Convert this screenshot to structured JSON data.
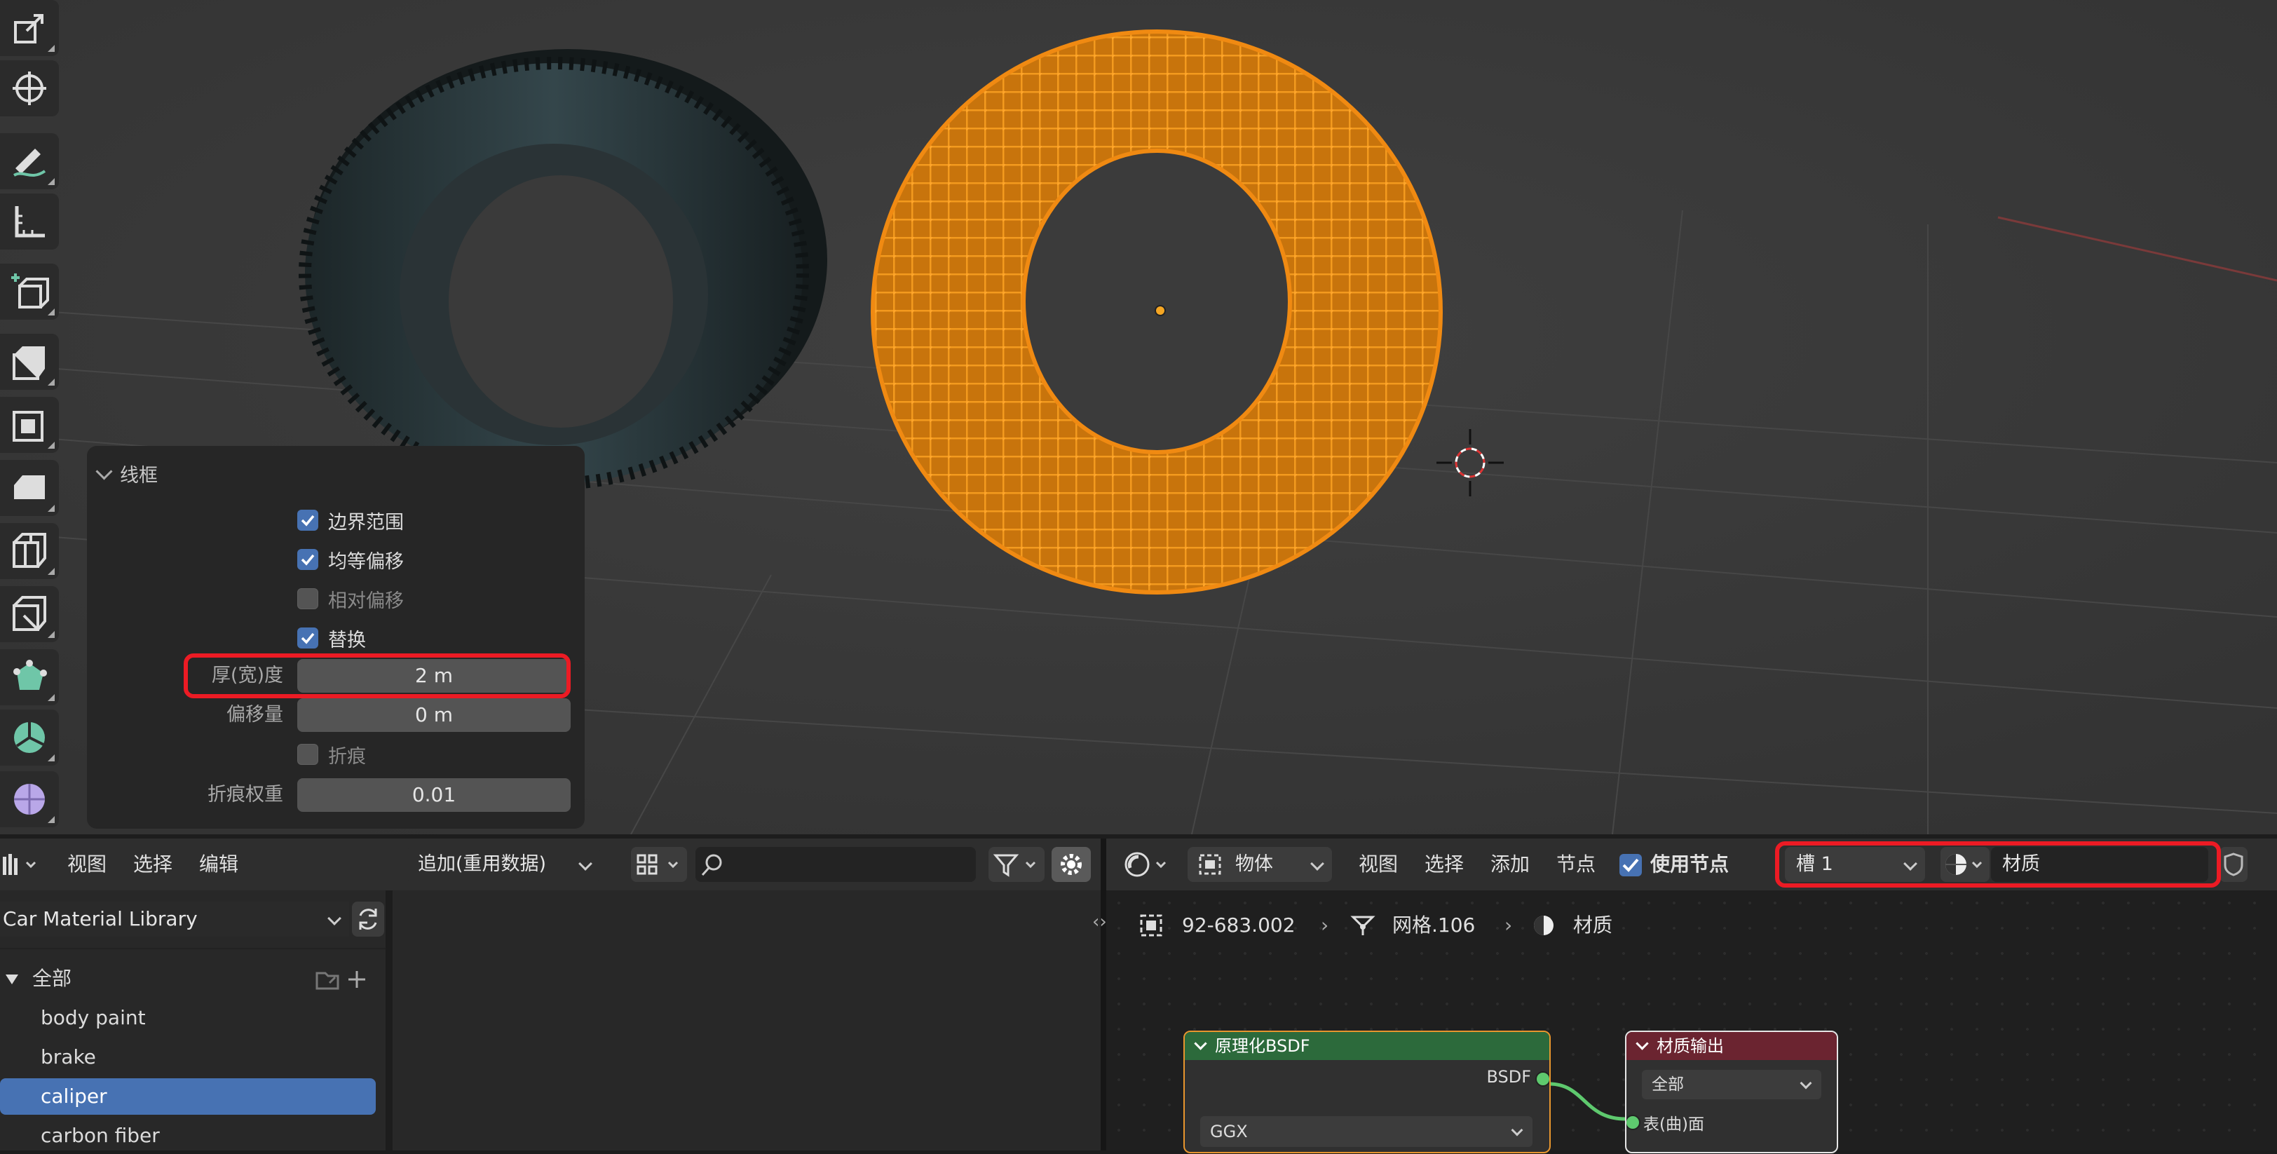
{
  "redo_panel": {
    "title": "线框",
    "checkboxes": [
      {
        "label": "边界范围",
        "checked": true
      },
      {
        "label": "均等偏移",
        "checked": true
      },
      {
        "label": "相对偏移",
        "checked": false
      },
      {
        "label": "替换",
        "checked": true
      },
      {
        "label": "折痕",
        "checked": false
      }
    ],
    "thickness": {
      "label": "厚(宽)度",
      "value": "2 m"
    },
    "offset": {
      "label": "偏移量",
      "value": "0 m"
    },
    "crease_weight": {
      "label": "折痕权重",
      "value": "0.01"
    }
  },
  "asset_browser": {
    "menu": [
      "视图",
      "选择",
      "编辑"
    ],
    "import_mode": "追加(重用数据)",
    "search_placeholder": "",
    "library": "Car Material Library",
    "categories": [
      {
        "label": "全部",
        "selected": false
      },
      {
        "label": "body paint",
        "selected": false
      },
      {
        "label": "brake",
        "selected": false
      },
      {
        "label": "caliper",
        "selected": true
      },
      {
        "label": "carbon fiber",
        "selected": false
      }
    ]
  },
  "node_editor": {
    "object_mode": "物体",
    "menu": [
      "视图",
      "选择",
      "添加",
      "节点"
    ],
    "use_nodes": {
      "label": "使用节点",
      "checked": true
    },
    "slot": "槽 1",
    "material": "材质",
    "breadcrumb": [
      "92-683.002",
      "网格.106",
      "材质"
    ],
    "bsdf_node": {
      "title": "原理化BSDF",
      "output": "BSDF",
      "distribution": "GGX"
    },
    "output_node": {
      "title": "材质输出",
      "target": "全部",
      "surface": "表(曲)面"
    }
  },
  "colors": {
    "accent": "#4772b3",
    "highlight_red": "#ec1b24",
    "selection_orange": "#f08a12",
    "bsdf_header": "#2c6a3b",
    "output_header": "#6b2430"
  }
}
